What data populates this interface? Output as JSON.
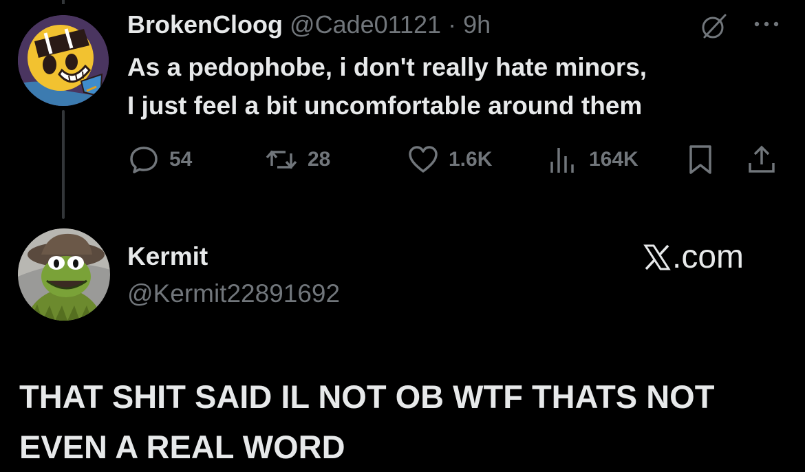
{
  "tweet": {
    "display_name": "BrokenCloog",
    "handle": "@Cade01121",
    "separator": "·",
    "time": "9h",
    "text_lines": [
      "As a pedophobe, i don't really hate minors,",
      "I just feel a bit uncomfortable around them"
    ],
    "actions": {
      "replies": "54",
      "retweets": "28",
      "likes": "1.6K",
      "views": "164K"
    },
    "icons": {
      "reply": "speech-bubble-icon",
      "retweet": "retweet-icon",
      "like": "heart-icon",
      "views": "analytics-bars-icon",
      "bookmark": "bookmark-icon",
      "share": "share-icon",
      "grok": "grok-slash-icon",
      "more": "ellipsis-icon"
    }
  },
  "reply": {
    "display_name": "Kermit",
    "handle": "@Kermit22891692",
    "site_label": ".com"
  },
  "caption": {
    "lines": [
      "THAT SHIT SAID IL NOT OB WTF THATS NOT",
      "EVEN A REAL WORD"
    ]
  },
  "colors": {
    "background": "#000000",
    "primary_text": "#e7e9ea",
    "secondary_text": "#71767b",
    "thread_line": "#333639"
  }
}
